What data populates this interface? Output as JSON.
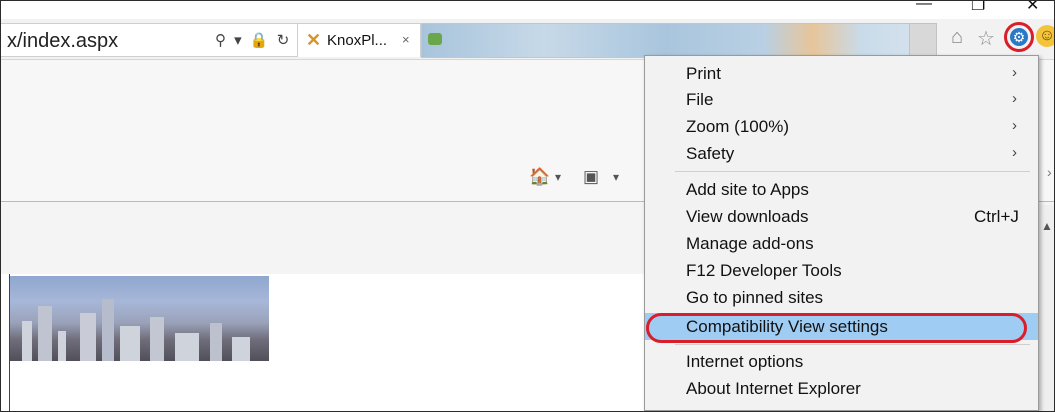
{
  "window": {
    "minimize_glyph": "—",
    "restore_glyph": "❐",
    "close_glyph": "✕"
  },
  "address_bar": {
    "url_text": "x/index.aspx",
    "controls_glyphs": "⚲ ▾ 🔒 ↻"
  },
  "tabs": {
    "active": {
      "logo_glyph": "✕",
      "title": "KnoxPl...",
      "close_glyph": "×"
    }
  },
  "toolbar": {
    "home_glyph": "⌂",
    "favorites_glyph": "☆",
    "tools_glyph": "⚙",
    "smiley_glyph": "☺"
  },
  "command_bar": {
    "home_glyph": "🏠",
    "dropdown_glyph": "▾",
    "feeds_glyph": "▣",
    "more_glyph": "›"
  },
  "menu": {
    "items": [
      {
        "label": "Print",
        "submenu": true
      },
      {
        "label": "File",
        "submenu": true
      },
      {
        "label": "Zoom (100%)",
        "submenu": true
      },
      {
        "label": "Safety",
        "submenu": true
      },
      {
        "label": "Add site to Apps"
      },
      {
        "label": "View downloads",
        "shortcut": "Ctrl+J"
      },
      {
        "label": "Manage add-ons"
      },
      {
        "label": "F12 Developer Tools"
      },
      {
        "label": "Go to pinned sites"
      },
      {
        "label": "Compatibility View settings",
        "highlighted": true
      },
      {
        "label": "Internet options"
      },
      {
        "label": "About Internet Explorer"
      }
    ],
    "submenu_arrow": "›"
  },
  "colors": {
    "highlight": "#9fccf2",
    "annotation_ring": "#d91e2a",
    "gear_blue": "#2a78c8"
  }
}
